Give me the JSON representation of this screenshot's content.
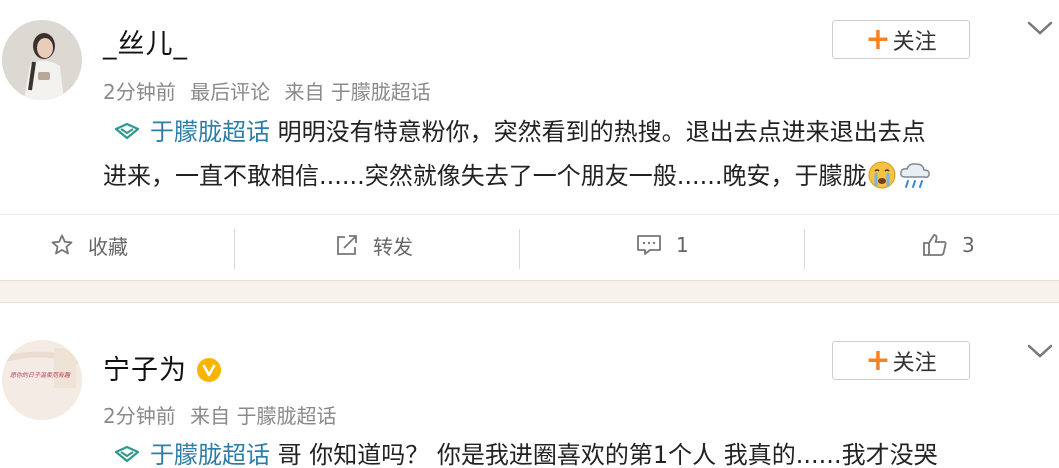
{
  "posts": [
    {
      "username": "_丝儿_",
      "meta": {
        "time": "2分钟前",
        "label": "最后评论",
        "source": "来自 于朦胧超话"
      },
      "follow_label": "关注",
      "content": {
        "topic": "于朦胧超话",
        "line1": "明明没有特意粉你，突然看到的热搜。退出去点进来退出去点",
        "line2": "进来，一直不敢相信......突然就像失去了一个朋友一般......晚安，于朦胧"
      },
      "actions": {
        "favorite": "收藏",
        "repost": "转发",
        "comments": "1",
        "likes": "3"
      }
    },
    {
      "username": "宁子为",
      "meta": {
        "time": "2分钟前",
        "source": "来自 于朦胧超话"
      },
      "follow_label": "关注",
      "avatar_text": "愿你的日子温柔而有趣",
      "content": {
        "topic": "于朦胧超话",
        "line1": "哥 你知道吗？ 你是我进圈喜欢的第1个人 我真的......我才没哭"
      }
    }
  ],
  "icons": [
    "super-topic-icon",
    "chevron-down-icon",
    "star-icon",
    "repost-icon",
    "comment-icon",
    "like-icon",
    "crying-emoji-icon",
    "rain-cloud-emoji-icon",
    "verified-badge-icon"
  ],
  "colors": {
    "accent": "#f7821f",
    "link": "#2e7da8",
    "separator": "#f7f3ec",
    "verified": "#f7b500"
  }
}
